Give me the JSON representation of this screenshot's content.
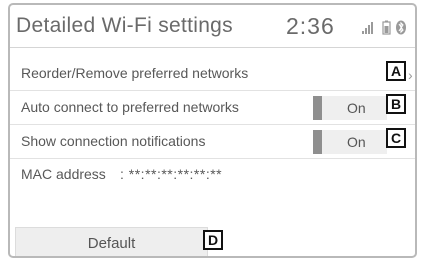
{
  "header": {
    "title": "Detailed Wi‑Fi settings",
    "clock": "2:36",
    "status_icons": [
      "signal-bars-icon",
      "battery-icon",
      "bluetooth-icon"
    ]
  },
  "rows": [
    {
      "label": "Reorder/Remove preferred networks"
    },
    {
      "label": "Auto connect to preferred networks",
      "toggle": "On"
    },
    {
      "label": "Show connection notifications",
      "toggle": "On"
    }
  ],
  "mac": {
    "label": "MAC address",
    "value": ": **:**:**:**:**:**"
  },
  "default_button": {
    "label": "Default"
  },
  "callouts": {
    "a": "A",
    "b": "B",
    "c": "C",
    "d": "D"
  },
  "colors": {
    "toggle_bar": "#8f8f8f",
    "toggle_bg": "#efefef",
    "button_bg": "#eeeeee"
  }
}
